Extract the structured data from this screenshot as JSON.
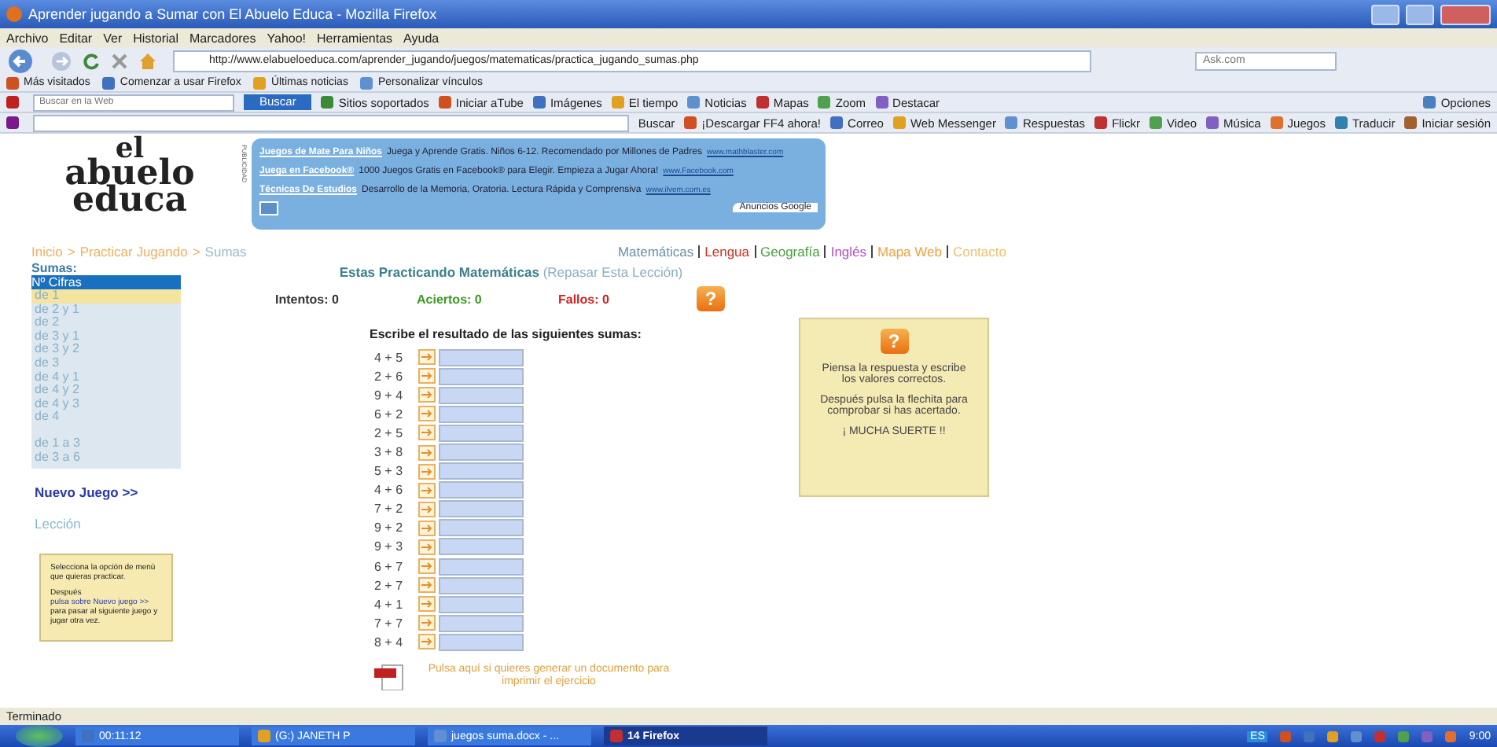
{
  "window": {
    "title": "Aprender jugando a Sumar con El Abuelo Educa - Mozilla Firefox"
  },
  "menu": [
    "Archivo",
    "Editar",
    "Ver",
    "Historial",
    "Marcadores",
    "Yahoo!",
    "Herramientas",
    "Ayuda"
  ],
  "nav": {
    "url": "http://www.elabueloeduca.com/aprender_jugando/juegos/matematicas/practica_jugando_sumas.php",
    "search_placeholder": "Ask.com"
  },
  "bookmarks": [
    "Más visitados",
    "Comenzar a usar Firefox",
    "Últimas noticias",
    "Personalizar vínculos"
  ],
  "ask_toolbar": {
    "search_placeholder": "Buscar en la Web",
    "button": "Buscar",
    "items": [
      "Sitios soportados",
      "Iniciar aTube",
      "Imágenes",
      "El tiempo",
      "Noticias",
      "Mapas",
      "Zoom",
      "Destacar"
    ],
    "options": "Opciones"
  },
  "yahoo_toolbar": {
    "items": [
      "Buscar",
      "¡Descargar FF4 ahora!",
      "Correo",
      "Web Messenger",
      "Respuestas",
      "Flickr",
      "Video",
      "Música",
      "Juegos",
      "Traducir",
      "Iniciar sesión"
    ]
  },
  "logo": [
    "el",
    "abuelo",
    "educa"
  ],
  "ads": {
    "label": "PUBLICIDAD",
    "items": [
      {
        "title": "Juegos de Mate Para Niños",
        "text": "Juega y Aprende Gratis. Niños 6-12. Recomendado por Millones de Padres",
        "url": "www.mathblaster.com"
      },
      {
        "title": "Juega en Facebook®",
        "text": "1000 Juegos Gratis en Facebook® para Elegir. Empieza a Jugar Ahora!",
        "url": "www.Facebook.com"
      },
      {
        "title": "Técnicas De Estudios",
        "text": "Desarrollo de la Memoria, Oratoria. Lectura Rápida y Comprensiva",
        "url": "www.ilvem.com.es"
      }
    ],
    "footer": "Anuncios Google"
  },
  "breadcrumb": {
    "items": [
      "Inicio",
      "Practicar Jugando",
      "Sumas"
    ],
    "separator": ">"
  },
  "subjects": [
    {
      "label": "Matemáticas",
      "color": "#6a8fa8"
    },
    {
      "label": "Lengua",
      "color": "#d03020"
    },
    {
      "label": "Geografía",
      "color": "#4aa040"
    },
    {
      "label": "Inglés",
      "color": "#b050c0"
    },
    {
      "label": "Mapa Web",
      "color": "#f0a040"
    },
    {
      "label": "Contacto",
      "color": "#f0c070"
    }
  ],
  "sidebar": {
    "title": "Sumas:",
    "header": "Nº Cifras",
    "items": [
      {
        "label": "de 1",
        "selected": true
      },
      {
        "label": "de 2 y 1",
        "selected": false
      },
      {
        "label": "de 2",
        "selected": false
      },
      {
        "label": "de 3 y 1",
        "selected": false
      },
      {
        "label": "de 3 y 2",
        "selected": false
      },
      {
        "label": "de 3",
        "selected": false
      },
      {
        "label": "de 4 y 1",
        "selected": false
      },
      {
        "label": "de 4 y 2",
        "selected": false
      },
      {
        "label": "de 4 y 3",
        "selected": false
      },
      {
        "label": "de 4",
        "selected": false
      }
    ],
    "ranges": [
      {
        "label": "de 1 a 3",
        "selected": false
      },
      {
        "label": "de 3 a 6",
        "selected": false
      }
    ],
    "new_game": "Nuevo Juego >>",
    "lesson": "Lección",
    "help": {
      "first": "Selecciona la opción de menú que quieras practicar.",
      "before": "Después",
      "link": "pulsa sobre Nuevo juego >>",
      "after": "para pasar al siguiente juego y jugar otra vez."
    }
  },
  "main": {
    "heading": "Estas Practicando Matemáticas",
    "review_link": "(Repasar Esta Lección)",
    "stats": [
      {
        "kind": "attempts",
        "label": "Intentos: 0"
      },
      {
        "kind": "hits",
        "label": "Aciertos: 0"
      },
      {
        "kind": "misses",
        "label": "Fallos: 0"
      }
    ],
    "help_button": "?",
    "instructions": "Escribe el resultado de las siguientes sumas:",
    "sums": [
      "4 + 5",
      "2 + 6",
      "9 + 4",
      "6 + 2",
      "2 + 5",
      "3 + 8",
      "5 + 3",
      "4 + 6",
      "7 + 2",
      "9 + 2",
      "9 + 3",
      "6 + 7",
      "2 + 7",
      "4 + 1",
      "7 + 7",
      "8 + 4"
    ],
    "pdf_link": "Pulsa aquí si quieres generar un documento para imprimir el ejercicio"
  },
  "tips": {
    "button": "?",
    "paragraphs": [
      "Piensa la respuesta y escribe los valores correctos.",
      "Después pulsa la flechita para comprobar si has acertado.",
      "¡ MUCHA SUERTE !!"
    ]
  },
  "status_bar": "Terminado",
  "taskbar": {
    "items": [
      "00:11:12",
      "(G:) JANETH P",
      "juegos suma.docx - ...",
      "14 Firefox"
    ],
    "language": "ES",
    "clock": "9:00"
  }
}
